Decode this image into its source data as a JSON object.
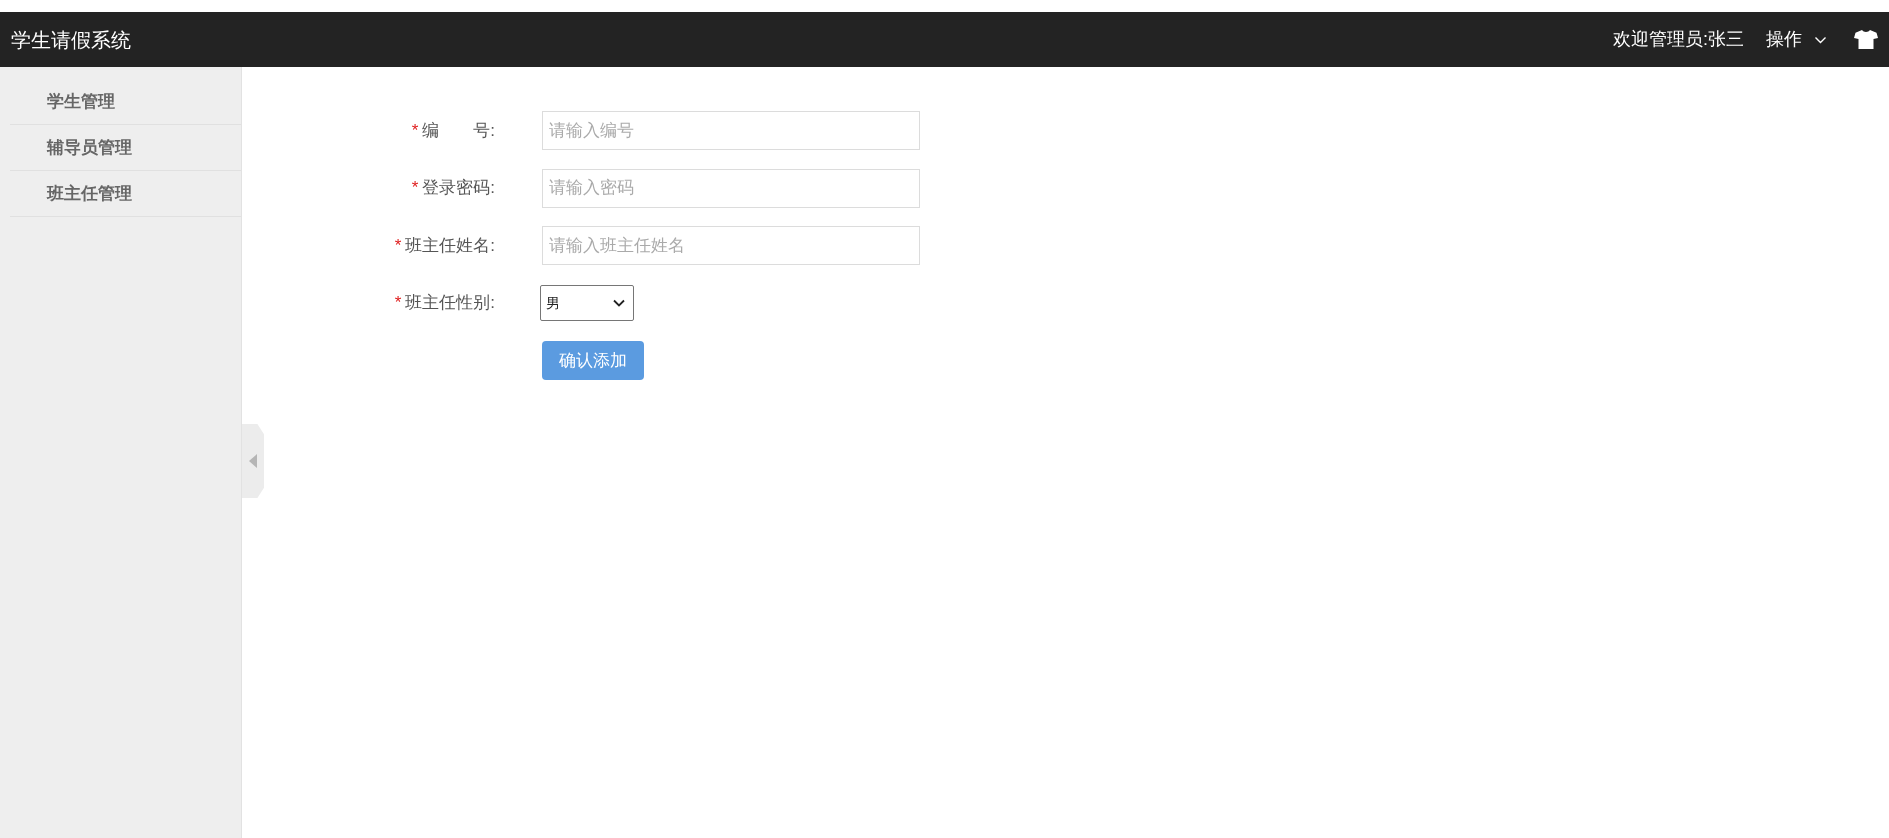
{
  "header": {
    "title": "学生请假系统",
    "welcome": "欢迎管理员:张三",
    "menu": {
      "label": "操作"
    }
  },
  "sidebar": {
    "items": [
      {
        "label": "学生管理"
      },
      {
        "label": "辅导员管理"
      },
      {
        "label": "班主任管理"
      }
    ]
  },
  "form": {
    "fields": [
      {
        "kind": "text",
        "required_mark": "*",
        "label": "编　　号:",
        "placeholder": "请输入编号"
      },
      {
        "kind": "text",
        "required_mark": "*",
        "label": "登录密码:",
        "placeholder": "请输入密码"
      },
      {
        "kind": "text",
        "required_mark": "*",
        "label": "班主任姓名:",
        "placeholder": "请输入班主任姓名"
      },
      {
        "kind": "select",
        "required_mark": "*",
        "label": "班主任性别:",
        "value": "男"
      }
    ],
    "submit": "确认添加"
  }
}
